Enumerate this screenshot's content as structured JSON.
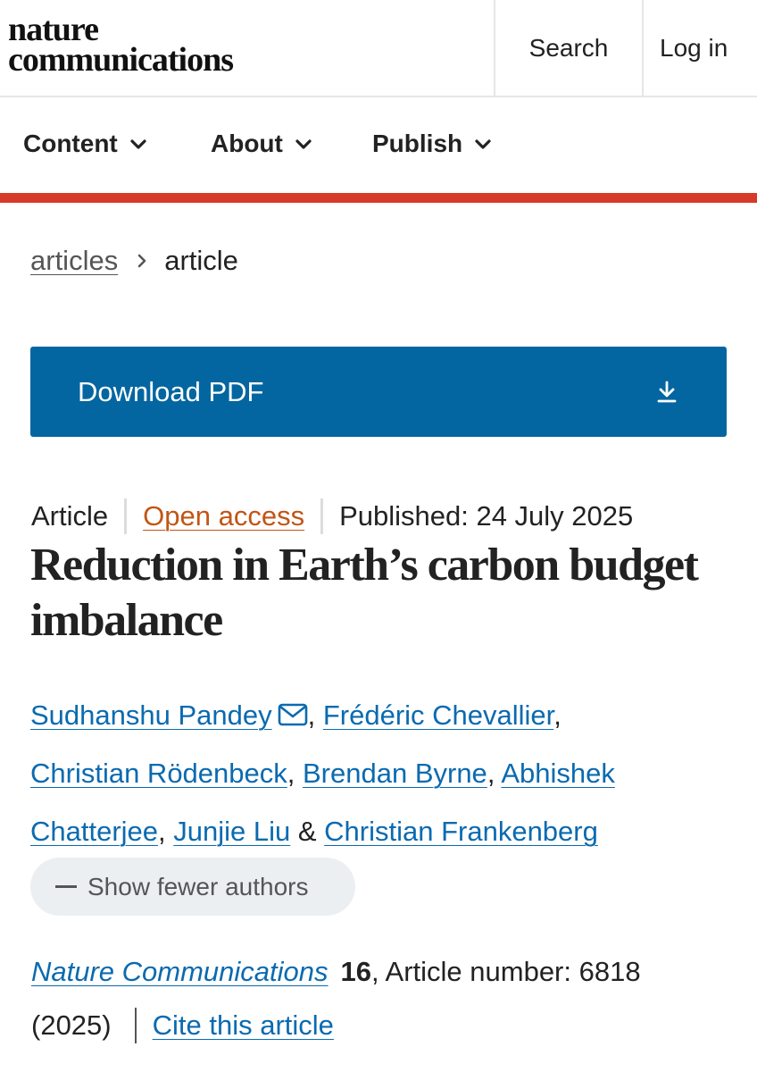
{
  "header": {
    "logo_line1": "nature",
    "logo_line2": "communications",
    "search_label": "Search",
    "login_label": "Log in"
  },
  "nav": {
    "items": [
      {
        "label": "Content",
        "icon": "chevron-down-icon"
      },
      {
        "label": "About",
        "icon": "chevron-down-icon"
      },
      {
        "label": "Publish",
        "icon": "chevron-down-icon"
      }
    ]
  },
  "breadcrumb": {
    "parent": "articles",
    "current": "article",
    "separator_icon": "chevron-right-icon"
  },
  "download": {
    "label": "Download PDF",
    "icon": "download-icon"
  },
  "article": {
    "type": "Article",
    "access": "Open access",
    "published": "Published: 24 July 2025",
    "title": "Reduction in Earth’s carbon budget imbalance",
    "authors": [
      {
        "name": "Sudhanshu Pandey",
        "suffix": ""
      },
      {
        "name": "Frédéric Chevallier",
        "suffix": ", "
      },
      {
        "name": "Christian Rödenbeck",
        "suffix": ", "
      },
      {
        "name": "Brendan Byrne",
        "suffix": ", "
      },
      {
        "name": "Abhishek Chatterjee",
        "suffix": ", "
      },
      {
        "name": "Junjie Liu",
        "suffix": " & "
      },
      {
        "name": "Christian Frankenberg",
        "suffix": ""
      }
    ],
    "show_fewer_label": "Show fewer authors",
    "journal": "Nature Communications",
    "volume": "16",
    "article_number": ", Article number: 6818",
    "year": "(2025)",
    "cite_label": "Cite this article"
  },
  "colors": {
    "accent_red": "#d73a28",
    "download_blue": "#0466a0",
    "link_blue": "#0a6ab0",
    "open_access_orange": "#c25514"
  }
}
